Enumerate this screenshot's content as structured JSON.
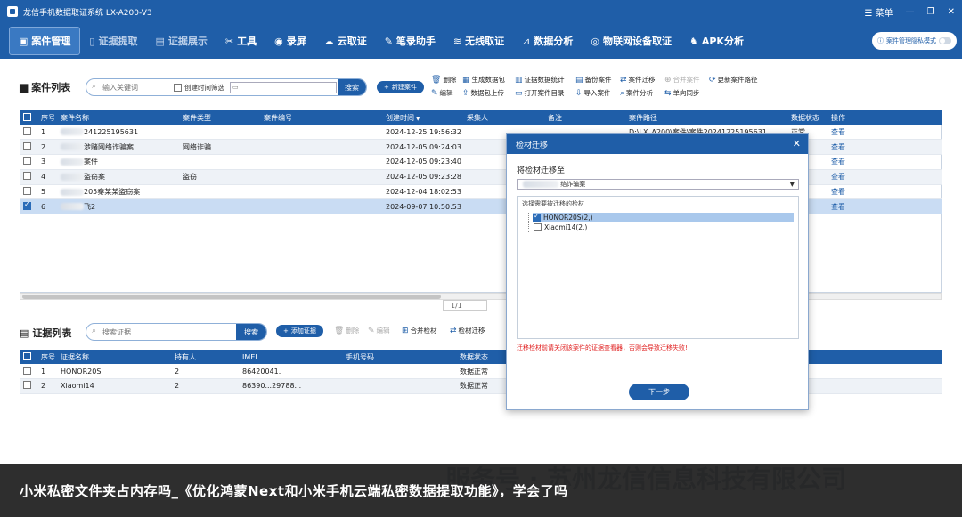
{
  "window": {
    "title": "龙信手机数据取证系统 LX-A200-V3",
    "menu_label": "菜单",
    "minimize": "—",
    "restore": "❐",
    "close": "✕"
  },
  "nav": {
    "items": [
      {
        "label": "案件管理",
        "icon": "▣"
      },
      {
        "label": "证据提取",
        "icon": "▯"
      },
      {
        "label": "证据展示",
        "icon": "▤"
      },
      {
        "label": "工具",
        "icon": "✂"
      },
      {
        "label": "录屏",
        "icon": "◉"
      },
      {
        "label": "云取证",
        "icon": "☁"
      },
      {
        "label": "笔录助手",
        "icon": "✎"
      },
      {
        "label": "无线取证",
        "icon": "≋"
      },
      {
        "label": "数据分析",
        "icon": "⊿"
      },
      {
        "label": "物联网设备取证",
        "icon": "◎"
      },
      {
        "label": "APK分析",
        "icon": "♞"
      }
    ],
    "privacy_label": "案件管理隐私模式"
  },
  "case_panel": {
    "title": "案件列表",
    "search_placeholder": "输入关键词",
    "time_filter_label": "创建时间筛选",
    "search_label": "搜索",
    "new_case_label": "新建案件",
    "toolbar_row1": [
      {
        "label": "删除",
        "icon": "🗑"
      },
      {
        "label": "生成数据包",
        "icon": "▦"
      },
      {
        "label": "证据数据统计",
        "icon": "▥"
      },
      {
        "label": "备份案件",
        "icon": "▤"
      },
      {
        "label": "案件迁移",
        "icon": "⇄"
      },
      {
        "label": "合并案件",
        "icon": "⊕"
      },
      {
        "label": "更新案件路径",
        "icon": "⟳"
      }
    ],
    "toolbar_row2": [
      {
        "label": "编辑",
        "icon": "✎"
      },
      {
        "label": "数据包上传",
        "icon": "⇪"
      },
      {
        "label": "打开案件目录",
        "icon": "▭"
      },
      {
        "label": "导入案件",
        "icon": "⇩"
      },
      {
        "label": "案件分析",
        "icon": "⌕"
      },
      {
        "label": "单向同步",
        "icon": "⇆"
      }
    ],
    "columns": [
      "序号",
      "案件名称",
      "案件类型",
      "案件编号",
      "创建时间",
      "采集人",
      "备注",
      "案件路径",
      "数据状态",
      "操作"
    ],
    "rows": [
      {
        "no": "1",
        "name": "241225195631",
        "type": "",
        "time": "2024-12-25 19:56:32",
        "path": "D:\\LX_A200\\案件\\案件20241225195631",
        "status": "正常",
        "op": "查看"
      },
      {
        "no": "2",
        "name": "涉赌网络诈骗案",
        "type": "网络诈骗",
        "time": "2024-12-05 09:24:03",
        "path": "",
        "status": "",
        "op": "查看"
      },
      {
        "no": "3",
        "name": "案件",
        "type": "",
        "time": "2024-12-05 09:23:40",
        "path": "",
        "status": "",
        "op": "查看"
      },
      {
        "no": "4",
        "name": "盗窃案",
        "type": "盗窃",
        "time": "2024-12-05 09:23:28",
        "path": "",
        "status": "",
        "op": "查看"
      },
      {
        "no": "5",
        "name": "205秦某某盗窃案",
        "type": "",
        "time": "2024-12-04 18:02:53",
        "path": "",
        "status": "",
        "op": "查看"
      },
      {
        "no": "6",
        "name": "飞2",
        "type": "",
        "time": "2024-09-07 10:50:53",
        "path": "",
        "status": "",
        "op": "查看"
      }
    ],
    "pager": "1/1"
  },
  "evidence_panel": {
    "title": "证据列表",
    "search_placeholder": "搜索证据",
    "search_label": "搜索",
    "add_label": "添加证据",
    "toolbar": [
      {
        "label": "删除",
        "icon": "🗑",
        "disabled": true
      },
      {
        "label": "编辑",
        "icon": "✎",
        "disabled": true
      },
      {
        "label": "合并检材",
        "icon": "⊞",
        "disabled": false
      },
      {
        "label": "检材迁移",
        "icon": "⇄",
        "disabled": false
      }
    ],
    "columns": [
      "序号",
      "证据名称",
      "持有人",
      "IMEI",
      "手机号码",
      "数据状态"
    ],
    "rows": [
      {
        "no": "1",
        "name": "HONOR20S",
        "holder": "2",
        "imei": "86420041.",
        "phone": "",
        "status": "数据正常"
      },
      {
        "no": "2",
        "name": "Xiaomi14",
        "holder": "2",
        "imei": "86390...29788...",
        "phone": "",
        "status": "数据正常"
      }
    ]
  },
  "dialog": {
    "title": "检材迁移",
    "close": "✕",
    "migrate_to_label": "将检材迁移至",
    "target_value": "络诈骗案",
    "tree_header": "选择需要被迁移的检材",
    "nodes": [
      {
        "label": "HONOR20S(2,)",
        "checked": true
      },
      {
        "label": "Xiaomi14(2,)",
        "checked": false
      }
    ],
    "warning": "迁移检材前请关闭该案件的证据查看器，否则会导致迁移失败!",
    "next_label": "下一步"
  },
  "caption": "小米私密文件夹占内存吗_《优化鸿蒙Next和小米手机云端私密数据提取功能》，学会了吗",
  "watermark": "服务号 · 苏州龙信信息科技有限公司"
}
